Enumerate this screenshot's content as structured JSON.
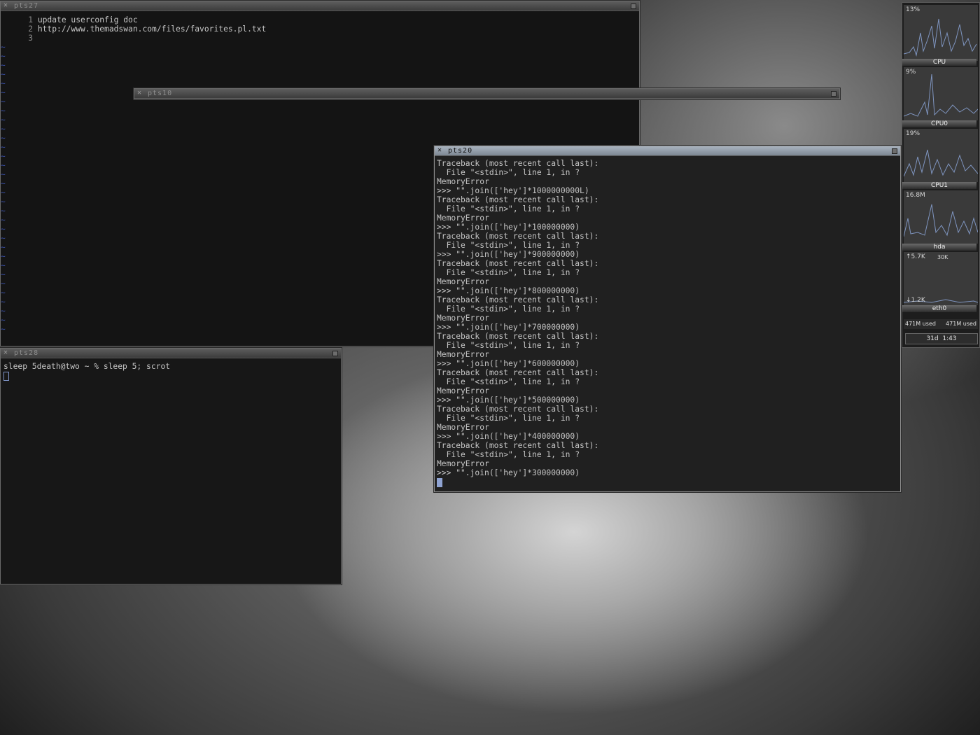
{
  "windows": {
    "pts27": {
      "title": "pts27",
      "lines": [
        {
          "num": "1",
          "text": "update userconfig doc"
        },
        {
          "num": "2",
          "text": "http://www.themadswan.com/files/favorites.pl.txt"
        },
        {
          "num": "3",
          "text": ""
        }
      ],
      "tilde": "~"
    },
    "pts10": {
      "title": "pts10"
    },
    "pts20": {
      "title": "pts20",
      "lines": [
        "Traceback (most recent call last):",
        "  File \"<stdin>\", line 1, in ?",
        "MemoryError",
        ">>> \"\".join(['hey']*1000000000L)",
        "Traceback (most recent call last):",
        "  File \"<stdin>\", line 1, in ?",
        "MemoryError",
        ">>> \"\".join(['hey']*100000000)",
        "Traceback (most recent call last):",
        "  File \"<stdin>\", line 1, in ?",
        ">>> \"\".join(['hey']*900000000)",
        "Traceback (most recent call last):",
        "  File \"<stdin>\", line 1, in ?",
        "MemoryError",
        ">>> \"\".join(['hey']*800000000)",
        "Traceback (most recent call last):",
        "  File \"<stdin>\", line 1, in ?",
        "MemoryError",
        ">>> \"\".join(['hey']*700000000)",
        "Traceback (most recent call last):",
        "  File \"<stdin>\", line 1, in ?",
        "MemoryError",
        ">>> \"\".join(['hey']*600000000)",
        "Traceback (most recent call last):",
        "  File \"<stdin>\", line 1, in ?",
        "MemoryError",
        ">>> \"\".join(['hey']*500000000)",
        "Traceback (most recent call last):",
        "  File \"<stdin>\", line 1, in ?",
        "MemoryError",
        ">>> \"\".join(['hey']*400000000)",
        "Traceback (most recent call last):",
        "  File \"<stdin>\", line 1, in ?",
        "MemoryError",
        ">>> \"\".join(['hey']*300000000)"
      ]
    },
    "pts28": {
      "title": "pts28",
      "line": "sleep 5death@two ~ % sleep 5; scrot"
    }
  },
  "gkrellm": {
    "cpu": {
      "percent": "13%",
      "name": "CPU"
    },
    "cpu0": {
      "percent": "9%",
      "name": "CPU0"
    },
    "cpu1": {
      "percent": "19%",
      "name": "CPU1"
    },
    "hda": {
      "value": "16.8M",
      "name": "hda"
    },
    "eth0": {
      "tx": "↑5.7K",
      "scale": "30K",
      "rx": "↓1.2K",
      "name": "eth0"
    },
    "mem": {
      "left": "471M used",
      "right": "471M used"
    },
    "uptime": "31d  1:43"
  },
  "colors": {
    "active_title": "#8f99a5",
    "tilde": "#3a4fa6",
    "cursor": "#8fa3d2"
  }
}
